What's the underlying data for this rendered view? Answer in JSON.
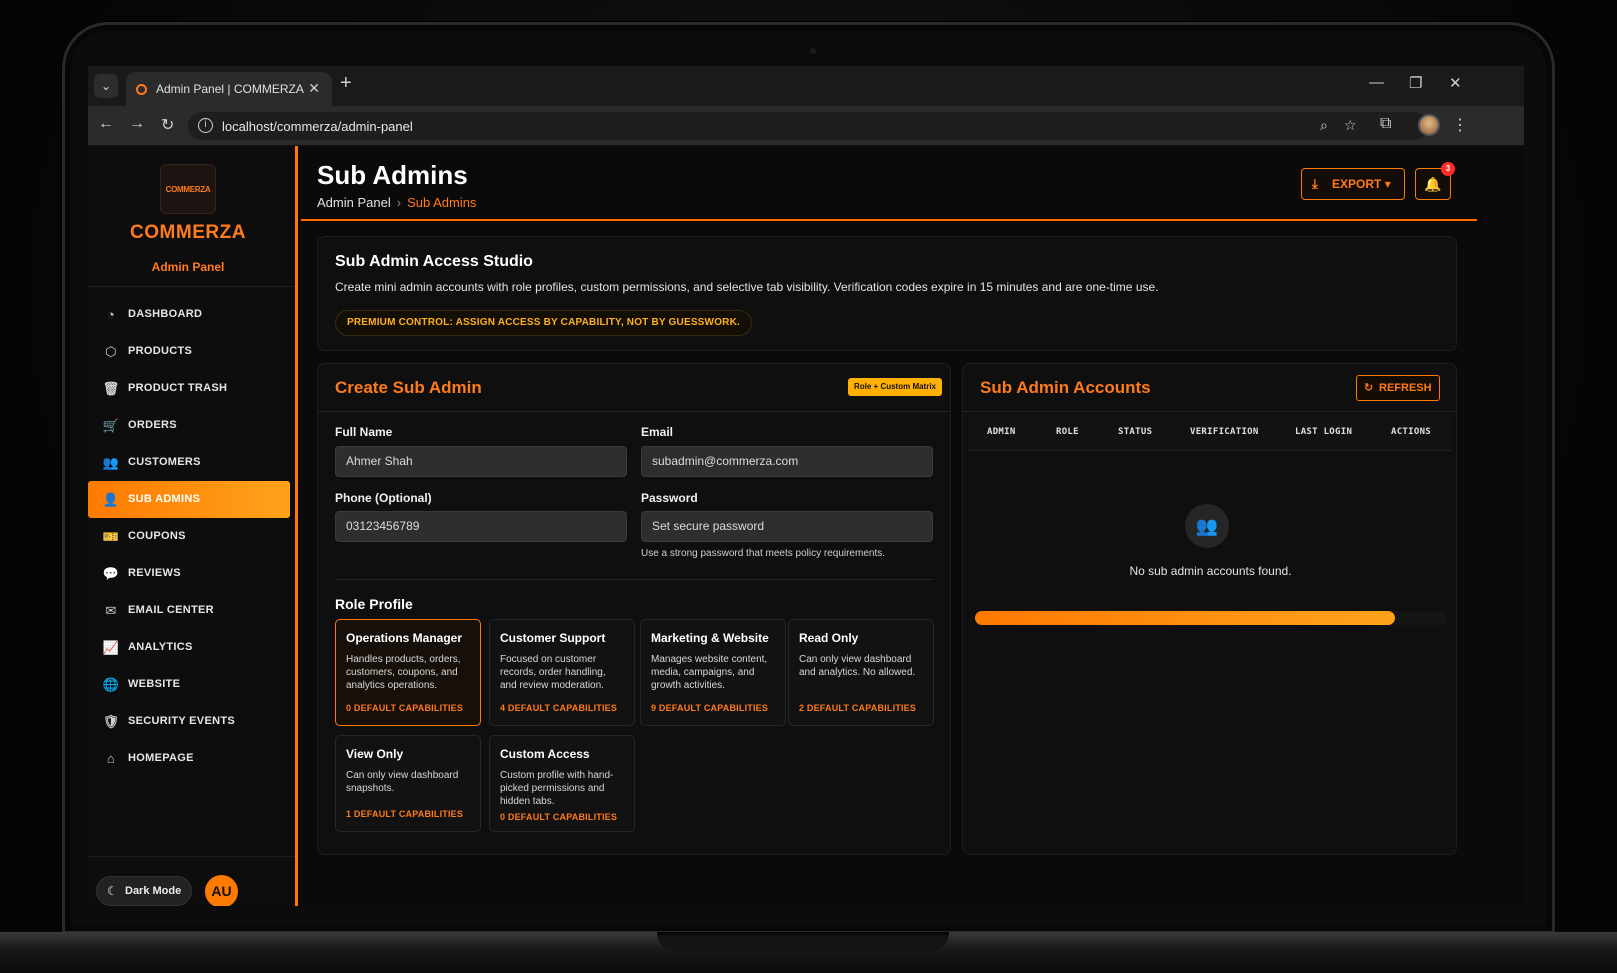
{
  "browser": {
    "tab_title": "Admin Panel | COMMERZA",
    "url": "localhost/commerza/admin-panel"
  },
  "sidebar": {
    "logo_text": "COMMERZA",
    "brand": "COMMERZA",
    "subtitle": "Admin Panel",
    "items": [
      {
        "label": "DASHBOARD",
        "icon": "dashboard-icon"
      },
      {
        "label": "PRODUCTS",
        "icon": "box-icon"
      },
      {
        "label": "PRODUCT TRASH",
        "icon": "trash-icon"
      },
      {
        "label": "ORDERS",
        "icon": "cart-icon"
      },
      {
        "label": "CUSTOMERS",
        "icon": "users-icon"
      },
      {
        "label": "SUB ADMINS",
        "icon": "user-shield-icon",
        "active": true
      },
      {
        "label": "COUPONS",
        "icon": "ticket-icon"
      },
      {
        "label": "REVIEWS",
        "icon": "chat-icon"
      },
      {
        "label": "EMAIL CENTER",
        "icon": "mail-icon"
      },
      {
        "label": "ANALYTICS",
        "icon": "analytics-icon"
      },
      {
        "label": "WEBSITE",
        "icon": "globe-icon"
      },
      {
        "label": "SECURITY EVENTS",
        "icon": "shield-icon"
      },
      {
        "label": "HOMEPAGE",
        "icon": "home-icon"
      }
    ],
    "dark_mode_label": "Dark Mode",
    "avatar_initials": "AU"
  },
  "header": {
    "title": "Sub Admins",
    "breadcrumb_root": "Admin Panel",
    "breadcrumb_sep": "›",
    "breadcrumb_current": "Sub Admins",
    "export_label": "EXPORT",
    "notification_count": "3"
  },
  "studio": {
    "title": "Sub Admin Access Studio",
    "description": "Create mini admin accounts with role profiles, custom permissions, and selective tab visibility. Verification codes expire in 15 minutes and are one-time use.",
    "pill": "PREMIUM CONTROL: ASSIGN ACCESS BY CAPABILITY, NOT BY GUESSWORK."
  },
  "create_form": {
    "title": "Create Sub Admin",
    "tag": "Role + Custom Matrix",
    "full_name_label": "Full Name",
    "full_name_value": "Ahmer Shah",
    "email_label": "Email",
    "email_value": "subadmin@commerza.com",
    "phone_label": "Phone (Optional)",
    "phone_value": "03123456789",
    "password_label": "Password",
    "password_placeholder": "Set secure password",
    "password_hint": "Use a strong password that meets policy requirements.",
    "role_profile_title": "Role Profile",
    "roles": [
      {
        "name": "Operations Manager",
        "desc": "Handles products, orders, customers, coupons, and analytics operations.",
        "caps": "0 DEFAULT CAPABILITIES",
        "selected": true
      },
      {
        "name": "Customer Support",
        "desc": "Focused on customer records, order handling, and review moderation.",
        "caps": "4 DEFAULT CAPABILITIES"
      },
      {
        "name": "Marketing & Website",
        "desc": "Manages website content, media, campaigns, and growth activities.",
        "caps": "9 DEFAULT CAPABILITIES"
      },
      {
        "name": "Read Only",
        "desc": "Can only view dashboard and analytics. No allowed.",
        "caps": "2 DEFAULT CAPABILITIES"
      },
      {
        "name": "View Only",
        "desc": "Can only view dashboard snapshots.",
        "caps": "1 DEFAULT CAPABILITIES"
      },
      {
        "name": "Custom Access",
        "desc": "Custom profile with hand-picked permissions and hidden tabs.",
        "caps": "0 DEFAULT CAPABILITIES"
      }
    ]
  },
  "accounts": {
    "title": "Sub Admin Accounts",
    "refresh_label": "REFRESH",
    "columns": [
      "ADMIN",
      "ROLE",
      "STATUS",
      "VERIFICATION",
      "LAST LOGIN",
      "ACTIONS"
    ],
    "empty_text": "No sub admin accounts found.",
    "progress": 0.89
  },
  "colors": {
    "accent": "#ff7a00",
    "accent_light": "#ffa31a",
    "tag_yellow": "#ffb000",
    "badge_red": "#ff2a2a"
  }
}
